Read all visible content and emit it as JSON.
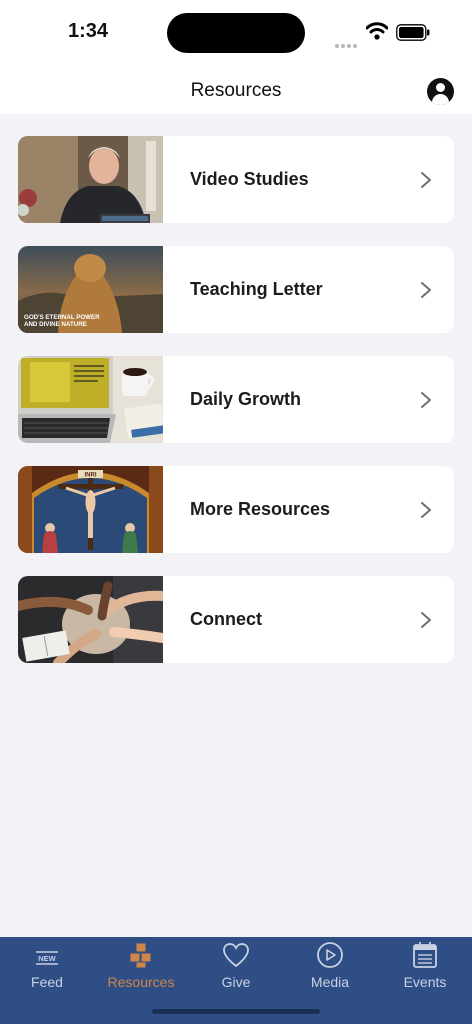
{
  "status_bar": {
    "time": "1:34"
  },
  "header": {
    "title": "Resources",
    "profile_icon": "person-circle-icon"
  },
  "resources": [
    {
      "label": "Video Studies",
      "thumb_icon": "video-studies-thumbnail"
    },
    {
      "label": "Teaching Letter",
      "thumb_icon": "teaching-letter-thumbnail",
      "thumb_caption": "GOD'S ETERNAL POWER AND DIVINE NATURE"
    },
    {
      "label": "Daily Growth",
      "thumb_icon": "daily-growth-thumbnail"
    },
    {
      "label": "More Resources",
      "thumb_icon": "more-resources-thumbnail",
      "thumb_caption": "INRI"
    },
    {
      "label": "Connect",
      "thumb_icon": "connect-thumbnail"
    }
  ],
  "tab_bar": {
    "active": "Resources",
    "tabs": [
      {
        "label": "Feed",
        "icon": "new-feed-icon",
        "badge": "NEW"
      },
      {
        "label": "Resources",
        "icon": "boxes-icon"
      },
      {
        "label": "Give",
        "icon": "heart-icon"
      },
      {
        "label": "Media",
        "icon": "play-circle-icon"
      },
      {
        "label": "Events",
        "icon": "calendar-icon"
      }
    ]
  },
  "colors": {
    "tab_bar_bg": "#2f4e86",
    "active_tab": "#d0864a",
    "inactive_tab": "#c9d1e2",
    "background": "#f2f2f7"
  }
}
